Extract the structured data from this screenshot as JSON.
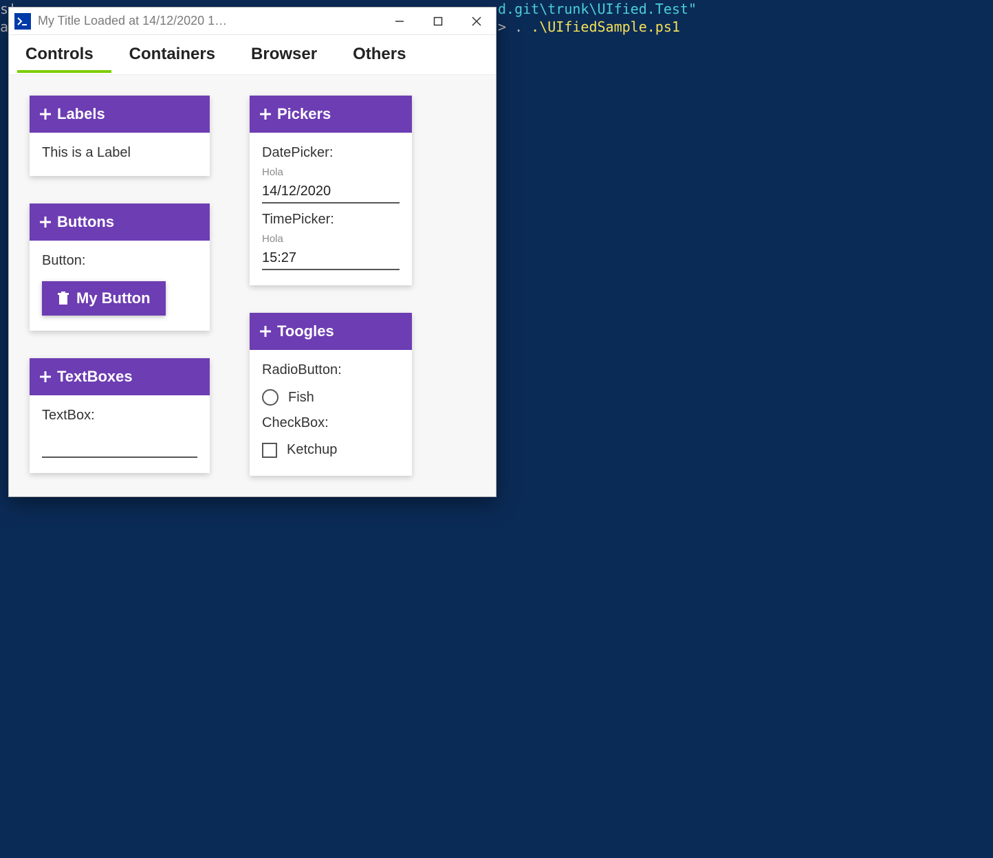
{
  "terminal": {
    "line1_fragment": "d.git\\trunk\\UIfied.Test\"",
    "line2_prompt": "> . ",
    "line2_cmd": ".\\UIfiedSample.ps1",
    "left_edge_1": "s'",
    "left_edge_2": "a"
  },
  "window": {
    "title": "My Title Loaded at 14/12/2020 1…"
  },
  "tabs": [
    {
      "label": "Controls",
      "active": true
    },
    {
      "label": "Containers",
      "active": false
    },
    {
      "label": "Browser",
      "active": false
    },
    {
      "label": "Others",
      "active": false
    }
  ],
  "cards": {
    "labels": {
      "header": "Labels",
      "body_text": "This is a Label"
    },
    "buttons": {
      "header": "Buttons",
      "field_label": "Button:",
      "button_text": "My Button"
    },
    "textboxes": {
      "header": "TextBoxes",
      "field_label": "TextBox:",
      "value": ""
    },
    "pickers": {
      "header": "Pickers",
      "date_label": "DatePicker:",
      "date_hint": "Hola",
      "date_value": "14/12/2020",
      "time_label": "TimePicker:",
      "time_hint": "Hola",
      "time_value": "15:27"
    },
    "toggles": {
      "header": "Toogles",
      "radio_label": "RadioButton:",
      "radio_option": "Fish",
      "checkbox_label": "CheckBox:",
      "checkbox_option": "Ketchup"
    }
  }
}
